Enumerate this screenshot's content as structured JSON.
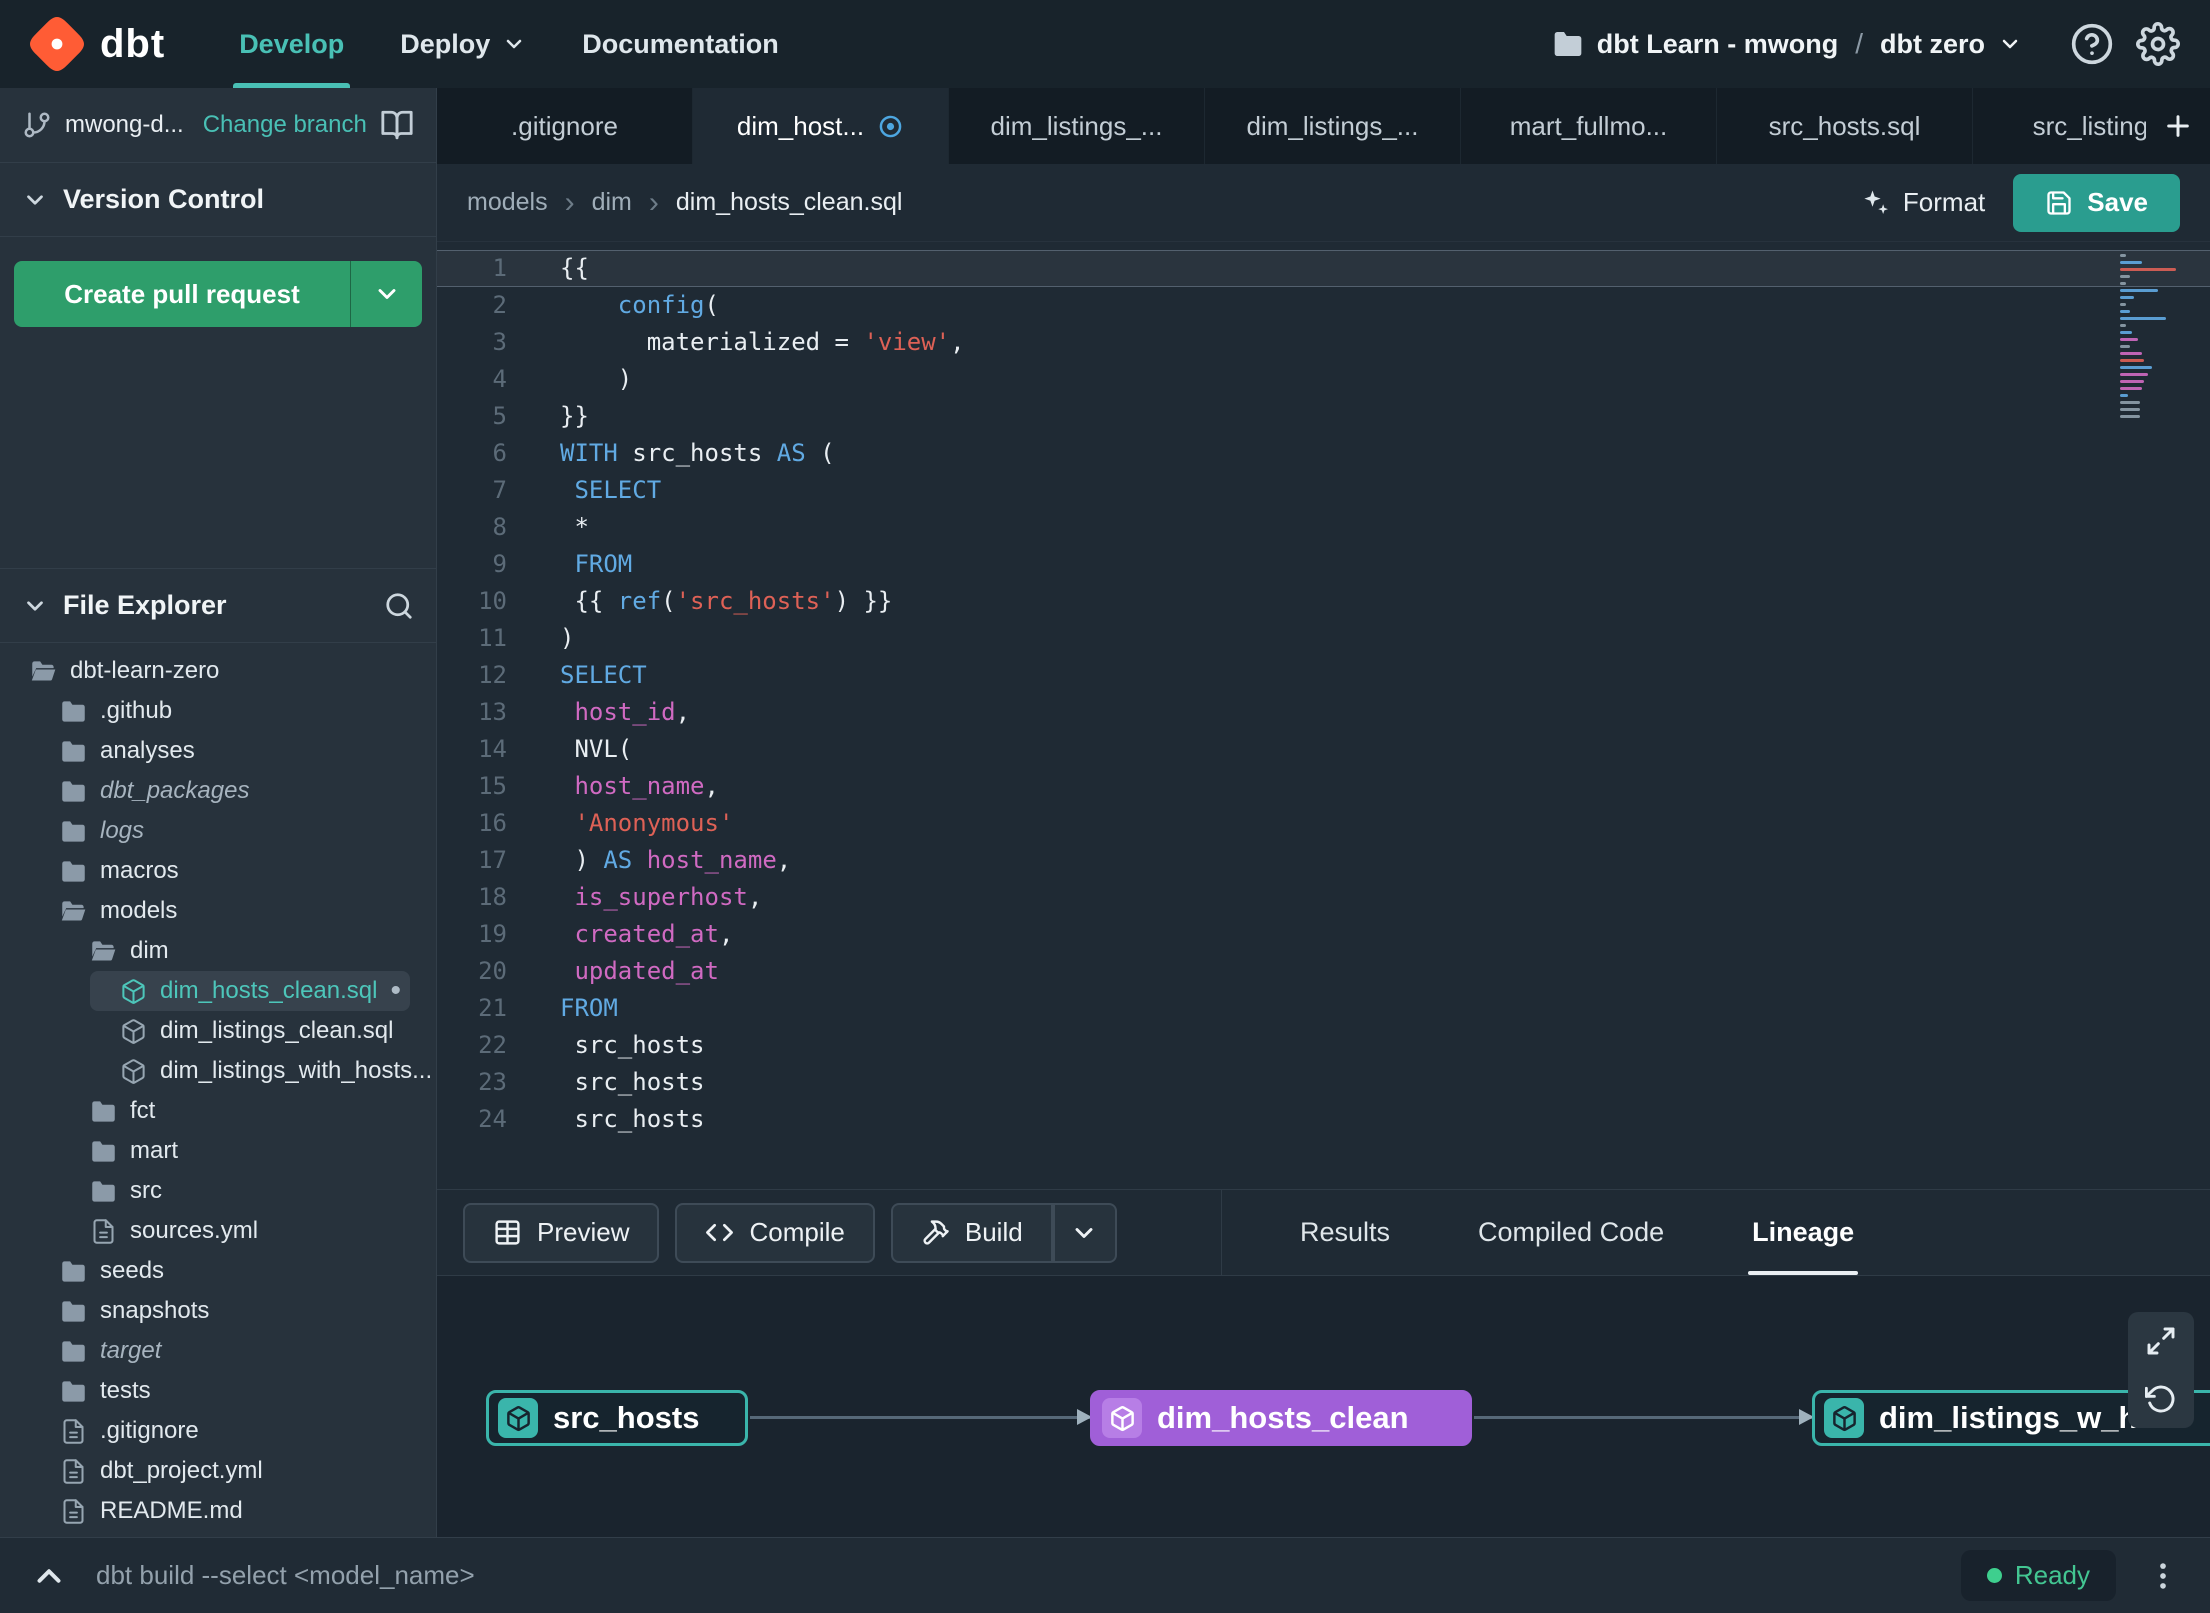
{
  "colors": {
    "accent_teal": "#49c0b5",
    "green_button": "#2e9e6b",
    "save_button": "#2a9d8f",
    "logo_orange": "#ff5c35",
    "node_purple": "#a05fd8",
    "ready_green": "#3ecf8e",
    "syntax": {
      "keyword": "#61aae3",
      "identifier": "#d06ac2",
      "string": "#de6156",
      "default": "#e9eef2"
    }
  },
  "icons": {
    "format": "sparkles",
    "save": "floppy-disk",
    "preview": "table-grid",
    "compile": "code-brackets",
    "build": "hammer",
    "lineage_expand": "maximize",
    "lineage_reset": "rotate-ccw",
    "tree_model": "cube",
    "tree_folder": "folder",
    "tree_file": "document"
  },
  "navbar": {
    "brand": "dbt",
    "items": [
      {
        "label": "Develop",
        "active": true
      },
      {
        "label": "Deploy",
        "caret": true
      },
      {
        "label": "Documentation"
      }
    ],
    "account": "dbt Learn - mwong",
    "separator": "/",
    "project": "dbt zero"
  },
  "sidebar": {
    "branch_name": "mwong-d...",
    "change_branch": "Change branch",
    "version_control_title": "Version Control",
    "create_pr": "Create pull request",
    "file_explorer_title": "File Explorer",
    "modified_dot": "•",
    "tree": [
      {
        "label": "dbt-learn-zero",
        "icon": "folder-open",
        "level": 0
      },
      {
        "label": ".github",
        "icon": "folder",
        "level": 1
      },
      {
        "label": "analyses",
        "icon": "folder",
        "level": 1
      },
      {
        "label": "dbt_packages",
        "icon": "folder",
        "level": 1,
        "italic": true
      },
      {
        "label": "logs",
        "icon": "folder",
        "level": 1,
        "italic": true
      },
      {
        "label": "macros",
        "icon": "folder",
        "level": 1
      },
      {
        "label": "models",
        "icon": "folder-open",
        "level": 1
      },
      {
        "label": "dim",
        "icon": "folder-open",
        "level": 2
      },
      {
        "label": "dim_hosts_clean.sql",
        "icon": "model",
        "level": 3,
        "selected": true,
        "modified": true
      },
      {
        "label": "dim_listings_clean.sql",
        "icon": "model",
        "level": 3
      },
      {
        "label": "dim_listings_with_hosts...",
        "icon": "model",
        "level": 3
      },
      {
        "label": "fct",
        "icon": "folder",
        "level": 2
      },
      {
        "label": "mart",
        "icon": "folder",
        "level": 2
      },
      {
        "label": "src",
        "icon": "folder",
        "level": 2
      },
      {
        "label": "sources.yml",
        "icon": "file",
        "level": 2
      },
      {
        "label": "seeds",
        "icon": "folder",
        "level": 1
      },
      {
        "label": "snapshots",
        "icon": "folder",
        "level": 1
      },
      {
        "label": "target",
        "icon": "folder",
        "level": 1,
        "italic": true
      },
      {
        "label": "tests",
        "icon": "folder",
        "level": 1
      },
      {
        "label": ".gitignore",
        "icon": "file",
        "level": 1
      },
      {
        "label": "dbt_project.yml",
        "icon": "file",
        "level": 1
      },
      {
        "label": "README.md",
        "icon": "file",
        "level": 1
      }
    ]
  },
  "editor_tabs": [
    {
      "label": ".gitignore"
    },
    {
      "label": "dim_host...",
      "active": true,
      "modified": true
    },
    {
      "label": "dim_listings_..."
    },
    {
      "label": "dim_listings_..."
    },
    {
      "label": "mart_fullmo..."
    },
    {
      "label": "src_hosts.sql"
    },
    {
      "label": "src_listings."
    }
  ],
  "breadcrumb": [
    "models",
    "dim",
    "dim_hosts_clean.sql"
  ],
  "actions": {
    "format": "Format",
    "save": "Save"
  },
  "code": {
    "lines": [
      {
        "n": 1,
        "cur": true,
        "seg": [
          [
            "d",
            "{{"
          ]
        ]
      },
      {
        "n": 2,
        "seg": [
          [
            "d",
            "    "
          ],
          [
            "k",
            "config"
          ],
          [
            "d",
            "("
          ]
        ]
      },
      {
        "n": 3,
        "seg": [
          [
            "d",
            "      materialized = "
          ],
          [
            "s",
            "'view'"
          ],
          [
            "d",
            ","
          ]
        ]
      },
      {
        "n": 4,
        "seg": [
          [
            "d",
            "    )"
          ]
        ]
      },
      {
        "n": 5,
        "seg": [
          [
            "d",
            "}}"
          ]
        ]
      },
      {
        "n": 6,
        "seg": [
          [
            "k",
            "WITH"
          ],
          [
            "d",
            " src_hosts "
          ],
          [
            "k",
            "AS"
          ],
          [
            "d",
            " ("
          ]
        ]
      },
      {
        "n": 7,
        "seg": [
          [
            "d",
            " "
          ],
          [
            "k",
            "SELECT"
          ]
        ]
      },
      {
        "n": 8,
        "seg": [
          [
            "d",
            " *"
          ]
        ]
      },
      {
        "n": 9,
        "seg": [
          [
            "d",
            " "
          ],
          [
            "k",
            "FROM"
          ]
        ]
      },
      {
        "n": 10,
        "seg": [
          [
            "d",
            " {{ "
          ],
          [
            "k",
            "ref"
          ],
          [
            "d",
            "("
          ],
          [
            "s",
            "'src_hosts'"
          ],
          [
            "d",
            ") }}"
          ]
        ]
      },
      {
        "n": 11,
        "seg": [
          [
            "d",
            ")"
          ]
        ]
      },
      {
        "n": 12,
        "seg": [
          [
            "k",
            "SELECT"
          ]
        ]
      },
      {
        "n": 13,
        "seg": [
          [
            "d",
            " "
          ],
          [
            "i",
            "host_id"
          ],
          [
            "d",
            ","
          ]
        ]
      },
      {
        "n": 14,
        "seg": [
          [
            "d",
            " NVL("
          ]
        ]
      },
      {
        "n": 15,
        "seg": [
          [
            "d",
            " "
          ],
          [
            "i",
            "host_name"
          ],
          [
            "d",
            ","
          ]
        ]
      },
      {
        "n": 16,
        "seg": [
          [
            "d",
            " "
          ],
          [
            "s",
            "'Anonymous'"
          ]
        ]
      },
      {
        "n": 17,
        "seg": [
          [
            "d",
            " ) "
          ],
          [
            "k",
            "AS"
          ],
          [
            "d",
            " "
          ],
          [
            "i",
            "host_name"
          ],
          [
            "d",
            ","
          ]
        ]
      },
      {
        "n": 18,
        "seg": [
          [
            "d",
            " "
          ],
          [
            "i",
            "is_superhost"
          ],
          [
            "d",
            ","
          ]
        ]
      },
      {
        "n": 19,
        "seg": [
          [
            "d",
            " "
          ],
          [
            "i",
            "created_at"
          ],
          [
            "d",
            ","
          ]
        ]
      },
      {
        "n": 20,
        "seg": [
          [
            "d",
            " "
          ],
          [
            "i",
            "updated_at"
          ]
        ]
      },
      {
        "n": 21,
        "seg": [
          [
            "k",
            "FROM"
          ]
        ]
      },
      {
        "n": 22,
        "seg": [
          [
            "d",
            " src_hosts"
          ]
        ]
      },
      {
        "n": 23,
        "seg": [
          [
            "d",
            " src_hosts"
          ]
        ]
      },
      {
        "n": 24,
        "seg": [
          [
            "d",
            " src_hosts"
          ]
        ]
      }
    ]
  },
  "bottom_panel": {
    "buttons": [
      {
        "label": "Preview"
      },
      {
        "label": "Compile"
      },
      {
        "label": "Build",
        "split": true
      }
    ],
    "tabs": [
      {
        "label": "Results"
      },
      {
        "label": "Compiled Code"
      },
      {
        "label": "Lineage",
        "active": true
      }
    ],
    "lineage": {
      "nodes": [
        {
          "label": "src_hosts",
          "style": "teal"
        },
        {
          "label": "dim_hosts_clean",
          "style": "purple"
        },
        {
          "label": "dim_listings_w_h",
          "style": "teal"
        }
      ]
    }
  },
  "command_bar": {
    "command": "dbt build --select <model_name>",
    "status": "Ready"
  }
}
